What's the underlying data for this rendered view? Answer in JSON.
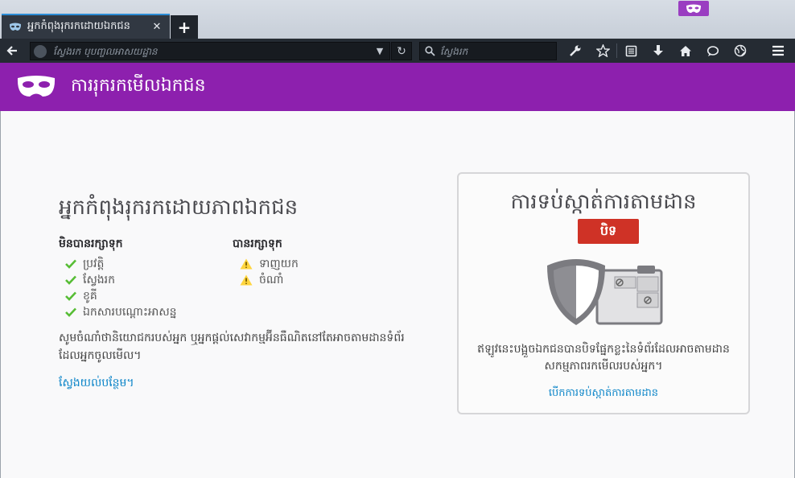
{
  "browser": {
    "tab": {
      "title": "អ្នកកំពុងរុករកដោយឯកជន",
      "close_glyph": "✕"
    },
    "new_tab_glyph": "+",
    "url_placeholder": "ស្វែងរក ឬបញ្ចូលអាសយដ្ឋាន",
    "search_placeholder": "ស្វែងរក",
    "url_dropdown_glyph": "▼",
    "reload_glyph": "↻",
    "toolbar_icons": [
      "wrench-icon",
      "bookmark-star-icon",
      "reading-list-icon",
      "download-icon",
      "home-icon",
      "chat-icon",
      "tracking-globe-icon",
      "hamburger-menu-icon"
    ]
  },
  "header": {
    "title": "ការរុករកមើលឯកជន"
  },
  "main": {
    "heading": "អ្នកកំពុងរុករកដោយភាពឯកជន",
    "not_saved": {
      "heading": "មិនបានរក្សាទុក",
      "items": [
        "ប្រវត្តិ",
        "ស្វែងរក",
        "ខូគី",
        "ឯកសារបណ្ដោះអាសន្ន"
      ]
    },
    "saved": {
      "heading": "បានរក្សាទុក",
      "items": [
        "ទាញយក",
        "ចំណាំ"
      ]
    },
    "description": "សូមចំណាំថានិយោជករបស់អ្នក ឬអ្នកផ្ដល់សេវាកម្មអ៊ីនធឺណិតនៅតែអាចតាមដានទំព័រដែលអ្នកចូលមើល។",
    "learn_more": "ស្វែងយល់បន្ថែម។"
  },
  "tracking_protection": {
    "title": "ការទប់ស្កាត់ការតាមដាន",
    "toggle_label": "បិទ",
    "description": "ឥឡូវនេះបង្អួចឯកជនបានបិទផ្នែកខ្លះនៃទំព័រដែលអាចតាមដានសកម្មភាពរកមើលរបស់អ្នក។",
    "link": "បើកការទប់ស្កាត់ការតាមដាន"
  },
  "colors": {
    "accent_purple": "#8d20ae",
    "toggle_red": "#cf3226",
    "link_blue": "#0a84c8",
    "check_green": "#57bd35",
    "warn_yellow": "#ffd53f"
  }
}
